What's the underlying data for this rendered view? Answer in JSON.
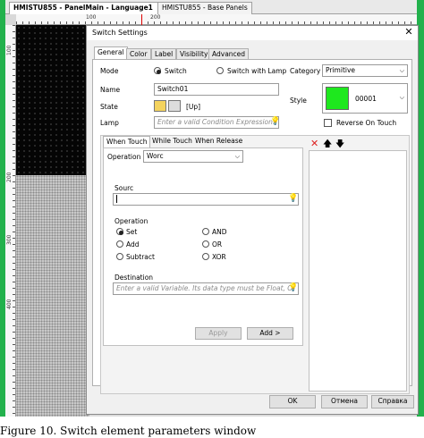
{
  "editor_tabs": [
    "HMISTU855 - PanelMain - Language1",
    "HMISTU855 - Base Panels"
  ],
  "ruler": {
    "top": [
      "100",
      "200"
    ],
    "left": [
      "100",
      "200",
      "300",
      "400"
    ]
  },
  "dialog": {
    "title": "Switch Settings",
    "tabs": [
      "General",
      "Color",
      "Label",
      "Visibility",
      "Advanced"
    ],
    "mode_label": "Mode",
    "mode_options": [
      "Switch",
      "Switch with Lamp"
    ],
    "category_label": "Category",
    "category_value": "Primitive",
    "name_label": "Name",
    "name_value": "Switch01",
    "style_label": "Style",
    "style_value": "00001",
    "style_color": "#1ee81e",
    "state_label": "State",
    "state_value": "[Up]",
    "lamp_label": "Lamp",
    "lamp_placeholder": "Enter a valid Condition Expression. Ty",
    "reverse_label": "Reverse On Touch",
    "sub_tabs": [
      "When Touch",
      "While Touch",
      "When Release"
    ],
    "operation_label": "Operation",
    "operation_value": "Worc",
    "source_label": "Sourc",
    "operation_group_label": "Operation",
    "ops": [
      "Set",
      "Add",
      "Subtract",
      "AND",
      "OR",
      "XOR"
    ],
    "destination_label": "Destination",
    "destination_placeholder": "Enter a valid Variable. Its data type must be Float, Or",
    "apply_label": "Apply",
    "add_label": "Add >",
    "ok_label": "OK",
    "cancel_label": "Отмена",
    "help_label": "Справка"
  },
  "caption": "Figure 10. Switch element parameters window"
}
